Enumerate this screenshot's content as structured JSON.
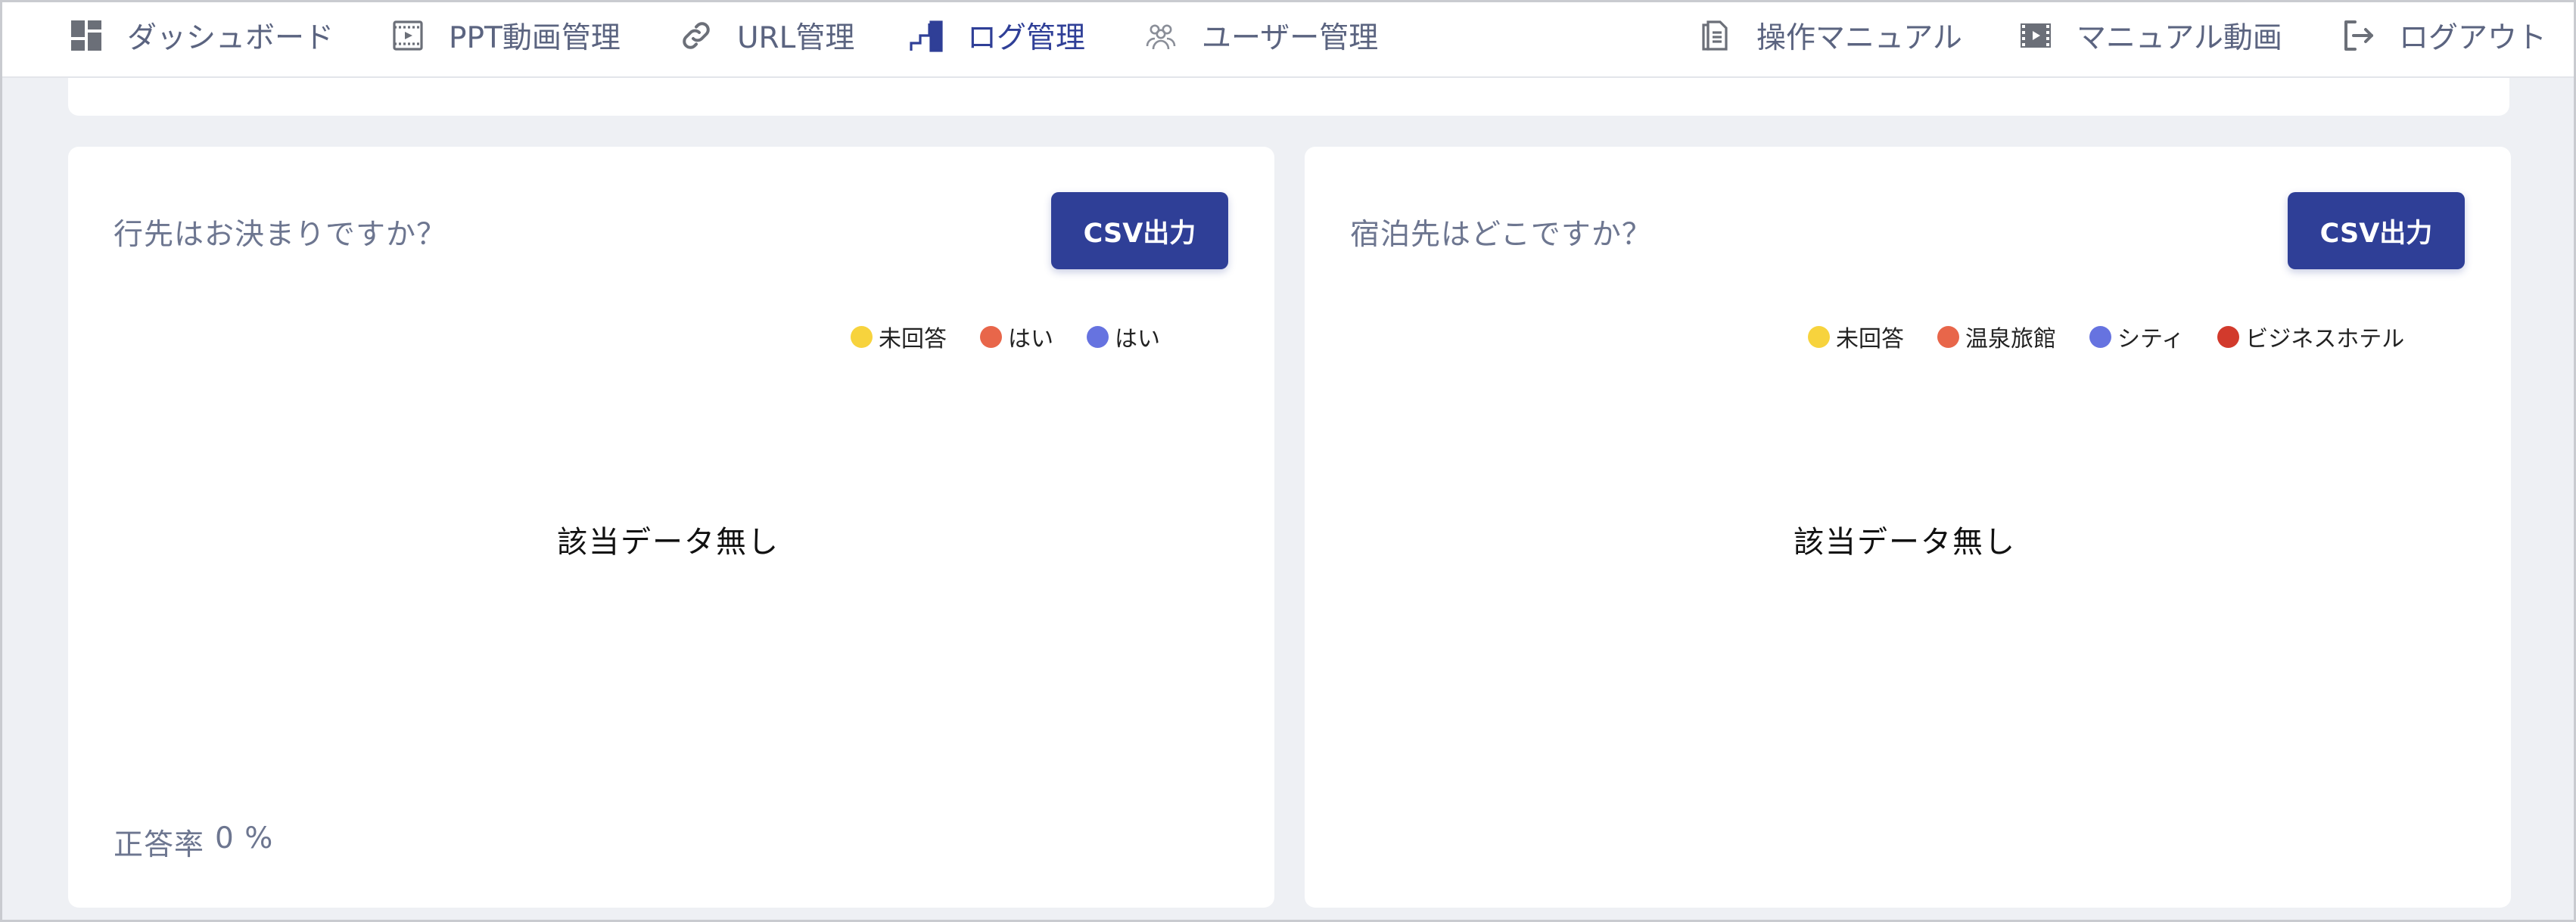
{
  "nav": {
    "items": [
      {
        "label": "ダッシュボード",
        "icon": "dashboard-icon"
      },
      {
        "label": "PPT動画管理",
        "icon": "video-file-icon"
      },
      {
        "label": "URL管理",
        "icon": "link-icon"
      },
      {
        "label": "ログ管理",
        "icon": "log-chart-icon",
        "active": true
      },
      {
        "label": "ユーザー管理",
        "icon": "users-icon"
      },
      {
        "label": "操作マニュアル",
        "icon": "document-icon"
      },
      {
        "label": "マニュアル動画",
        "icon": "film-icon"
      },
      {
        "label": "ログアウト",
        "icon": "logout-icon"
      }
    ]
  },
  "cards": [
    {
      "title": "行先はお決まりですか？",
      "csv_label": "CSV出力",
      "legend": [
        {
          "label": "未回答",
          "color": "#f7d33d"
        },
        {
          "label": "はい",
          "color": "#e8664a"
        },
        {
          "label": "はい",
          "color": "#6673e0"
        }
      ],
      "empty_text": "該当データ無し",
      "rate_label": "正答率",
      "rate_value": "0 %"
    },
    {
      "title": "宿泊先はどこですか？",
      "csv_label": "CSV出力",
      "legend": [
        {
          "label": "未回答",
          "color": "#f7d33d"
        },
        {
          "label": "温泉旅館",
          "color": "#e8664a"
        },
        {
          "label": "シティ",
          "color": "#6673e0"
        },
        {
          "label": "ビジネスホテル",
          "color": "#d23a2c"
        }
      ],
      "empty_text": "該当データ無し"
    }
  ],
  "colors": {
    "accent": "#2f3f97",
    "nav_text": "#5b6480",
    "background": "#eef0f4"
  }
}
